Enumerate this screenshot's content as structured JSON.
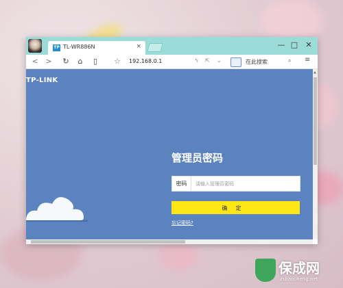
{
  "browser": {
    "tab_title": "TL-WR886N",
    "tab_favicon_text": "TP",
    "url": "192.168.0.1",
    "search_placeholder": "在此搜索"
  },
  "page": {
    "logo": "TP-LINK",
    "login_title": "管理员密码",
    "password_label": "密码",
    "password_placeholder": "请输入管理员密码",
    "confirm_label": "确定",
    "forgot_link": "忘记密码?"
  },
  "watermark": {
    "title": "保成网",
    "subtitle": "zsbaocheng.net"
  },
  "colors": {
    "titlebar": "#9bdbd8",
    "page_background": "#5b83c0",
    "confirm_button": "#ffe716"
  }
}
